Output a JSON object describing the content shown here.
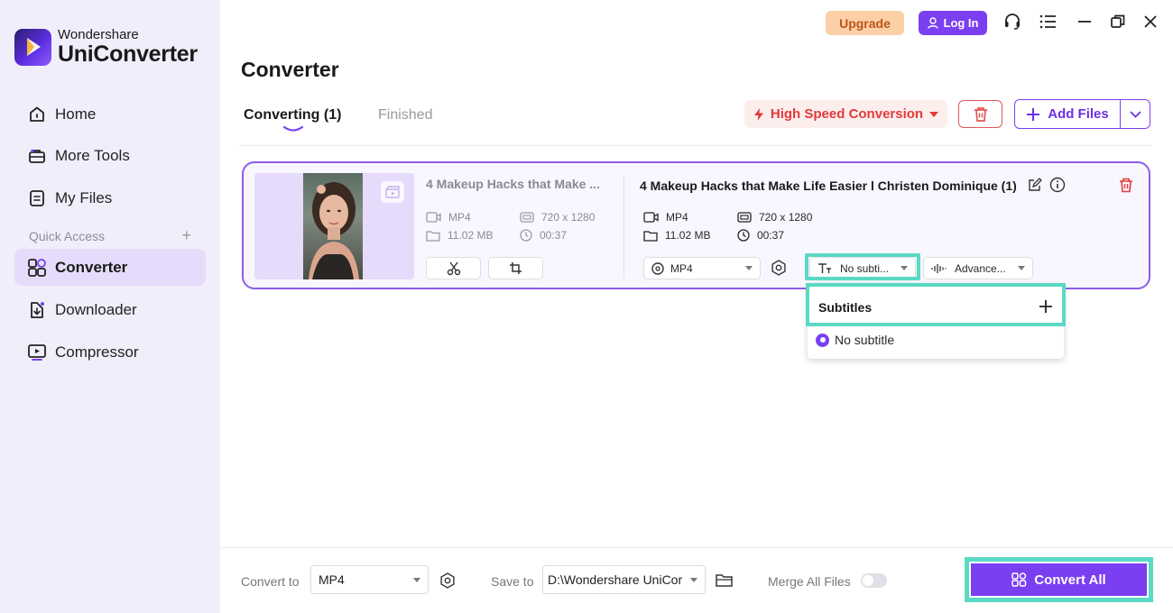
{
  "app": {
    "brand_line1": "Wondershare",
    "brand_line2": "UniConverter"
  },
  "sidebar": {
    "items": [
      {
        "label": "Home",
        "icon": "home-icon"
      },
      {
        "label": "More Tools",
        "icon": "toolbox-icon"
      },
      {
        "label": "My Files",
        "icon": "file-icon"
      },
      {
        "label": "Converter",
        "icon": "converter-icon",
        "active": true
      },
      {
        "label": "Downloader",
        "icon": "download-icon"
      },
      {
        "label": "Compressor",
        "icon": "compress-icon"
      }
    ],
    "quick_access_label": "Quick Access"
  },
  "topbar": {
    "upgrade_label": "Upgrade",
    "login_label": "Log In"
  },
  "page": {
    "title": "Converter",
    "tabs": [
      {
        "label": "Converting (1)",
        "active": true
      },
      {
        "label": "Finished",
        "active": false
      }
    ],
    "high_speed_label": "High Speed Conversion",
    "add_files_label": "Add Files"
  },
  "file": {
    "source_title": "4 Makeup Hacks that Make ...",
    "source_format": "MP4",
    "source_size": "11.02 MB",
    "source_resolution": "720 x 1280",
    "source_duration": "00:37",
    "output_title": "4 Makeup Hacks that Make Life Easier l Christen Dominique (1)",
    "output_format": "MP4",
    "output_size": "11.02 MB",
    "output_resolution": "720 x 1280",
    "output_duration": "00:37",
    "format_select": "MP4",
    "subtitle_select": "No subti...",
    "audio_select": "Advance..."
  },
  "subtitle_dropdown": {
    "header": "Subtitles",
    "options": [
      {
        "label": "No subtitle",
        "selected": true
      }
    ]
  },
  "bottom": {
    "convert_to_label": "Convert to",
    "convert_to_value": "MP4",
    "save_to_label": "Save to",
    "save_to_value": "D:\\Wondershare UniCor",
    "merge_label": "Merge All Files",
    "merge_enabled": false,
    "convert_all_label": "Convert All"
  },
  "colors": {
    "accent": "#7b3ff2",
    "highlight": "#5ad9c4",
    "danger": "#e23a3a",
    "upgrade_bg": "#fbd0a7"
  }
}
